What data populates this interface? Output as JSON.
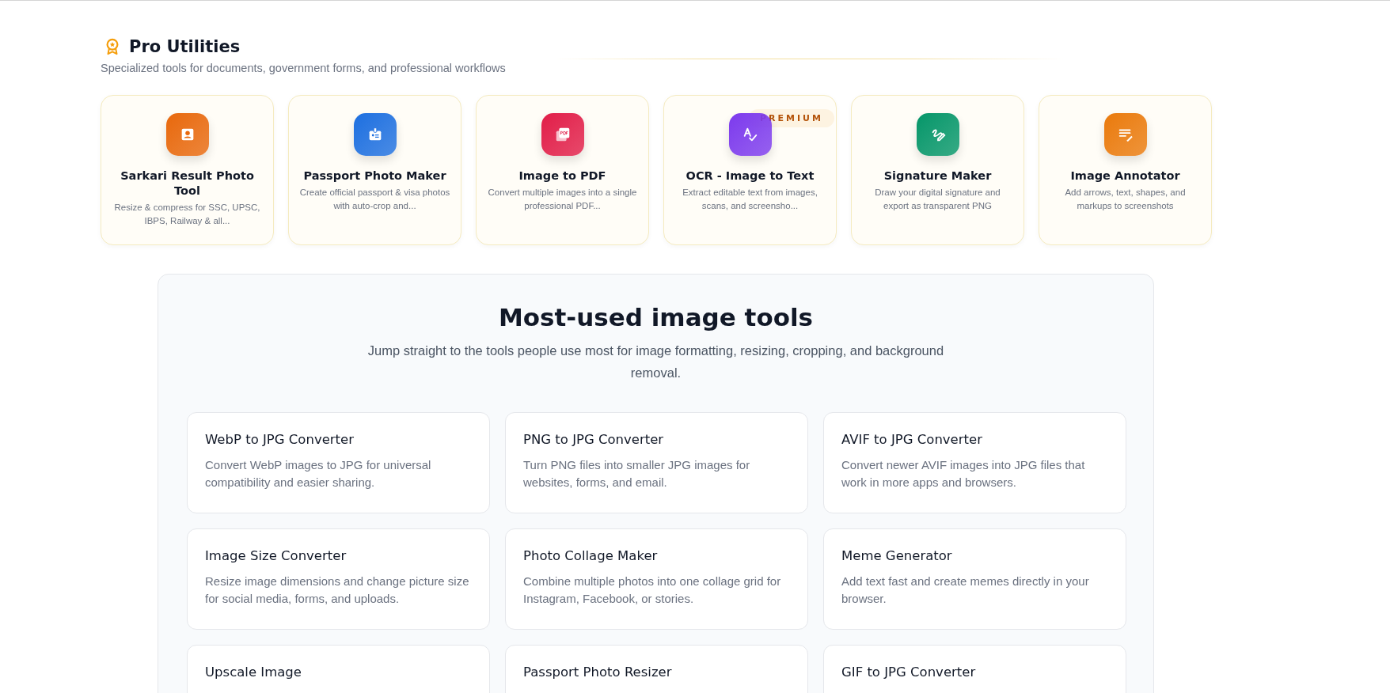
{
  "pro_utilities": {
    "title": "Pro Utilities",
    "subtitle": "Specialized tools for documents, government forms, and professional workflows",
    "tools": [
      {
        "title": "Sarkari Result Photo Tool",
        "description": "Resize & compress for SSC, UPSC, IBPS, Railway & all...",
        "kind": "portrait",
        "color": "#e8680c"
      },
      {
        "title": "Passport Photo Maker",
        "description": "Create official passport & visa photos with auto-crop and...",
        "kind": "badge",
        "color": "#1d6fe0"
      },
      {
        "title": "Image to PDF",
        "description": "Convert multiple images into a single professional PDF...",
        "kind": "pdf",
        "color": "#e11d48"
      },
      {
        "title": "OCR - Image to Text",
        "description": "Extract editable text from images, scans, and screensho...",
        "kind": "spellcheck",
        "color": "#7c3aed",
        "badge": "PREMIUM"
      },
      {
        "title": "Signature Maker",
        "description": "Draw your digital signature and export as transparent PNG",
        "kind": "signature",
        "color": "#059669"
      },
      {
        "title": "Image Annotator",
        "description": "Add arrows, text, shapes, and markups to screenshots",
        "kind": "notes",
        "color": "#ea7a0c"
      }
    ]
  },
  "most_used": {
    "title": "Most-used image tools",
    "subtitle": "Jump straight to the tools people use most for image formatting, resizing, cropping, and background removal.",
    "tools": [
      {
        "title": "WebP to JPG Converter",
        "description": "Convert WebP images to JPG for universal compatibility and easier sharing."
      },
      {
        "title": "PNG to JPG Converter",
        "description": "Turn PNG files into smaller JPG images for websites, forms, and email."
      },
      {
        "title": "AVIF to JPG Converter",
        "description": "Convert newer AVIF images into JPG files that work in more apps and browsers."
      },
      {
        "title": "Image Size Converter",
        "description": "Resize image dimensions and change picture size for social media, forms, and uploads."
      },
      {
        "title": "Photo Collage Maker",
        "description": "Combine multiple photos into one collage grid for Instagram, Facebook, or stories."
      },
      {
        "title": "Meme Generator",
        "description": "Add text fast and create memes directly in your browser."
      },
      {
        "title": "Upscale Image"
      },
      {
        "title": "Passport Photo Resizer"
      },
      {
        "title": "GIF to JPG Converter"
      }
    ]
  }
}
